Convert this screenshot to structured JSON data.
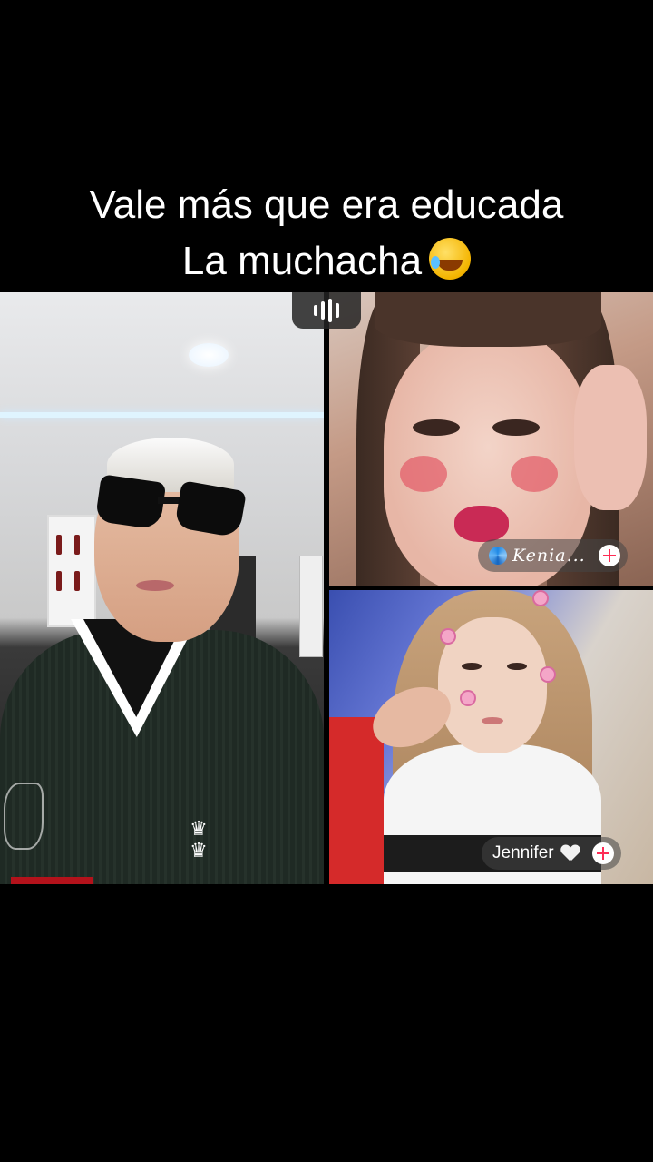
{
  "caption": {
    "line1": "Vale más que era educada",
    "line2": "La muchacha",
    "emoji_icon": "rolling-on-floor-laughing-emoji"
  },
  "live": {
    "audio_indicator_icon": "audio-bars-icon",
    "participants": [
      {
        "name": "Kenia...",
        "badge_icon": "swirl-icon",
        "follow_icon": "plus-icon"
      },
      {
        "name": "Jennifer",
        "badge_icon": "white-heart-icon",
        "follow_icon": "plus-icon"
      }
    ]
  },
  "colors": {
    "background": "#000000",
    "caption_text": "#ffffff",
    "follow_accent": "#fe2c55"
  }
}
